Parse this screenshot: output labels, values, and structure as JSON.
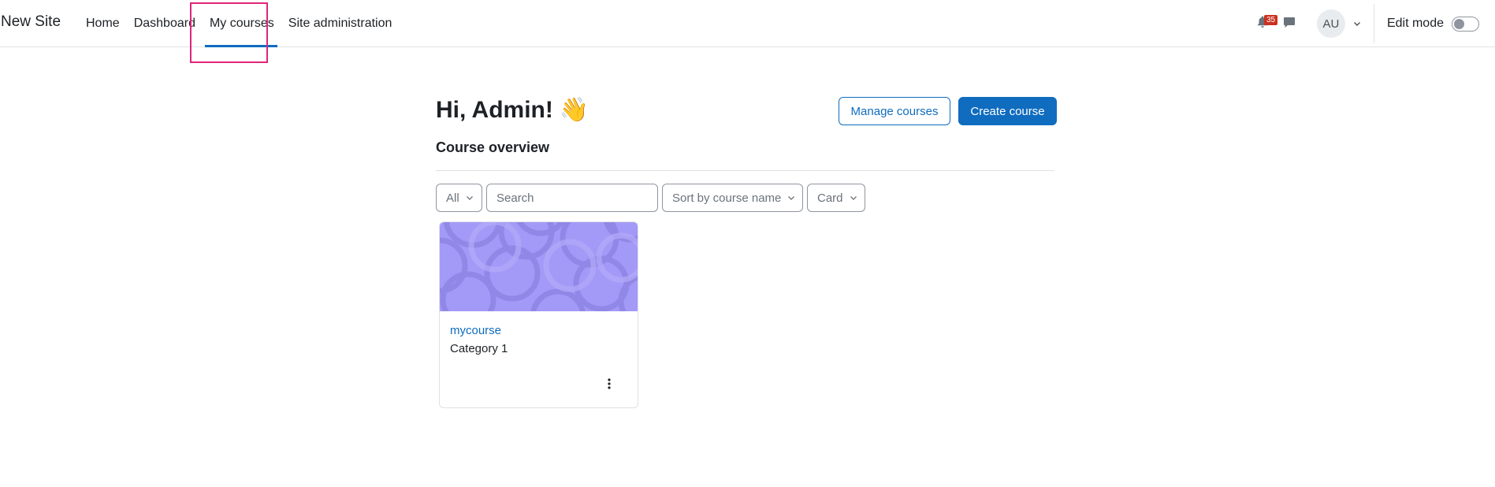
{
  "navbar": {
    "site_name": "New Site",
    "items": [
      {
        "label": "Home"
      },
      {
        "label": "Dashboard"
      },
      {
        "label": "My courses",
        "active": true
      },
      {
        "label": "Site administration"
      }
    ],
    "notifications": {
      "count": "35",
      "icon": "bell-icon"
    },
    "messages": {
      "icon": "chat-icon"
    },
    "user": {
      "initials": "AU"
    },
    "edit_mode": {
      "label": "Edit mode",
      "enabled": false
    }
  },
  "main": {
    "greeting": "Hi, Admin!",
    "greeting_emoji": "👋",
    "manage_courses_label": "Manage courses",
    "create_course_label": "Create course",
    "section_title": "Course overview",
    "filters": {
      "grouping": "All",
      "search_placeholder": "Search",
      "sort": "Sort by course name",
      "view": "Card"
    },
    "courses": [
      {
        "name": "mycourse",
        "category": "Category 1"
      }
    ]
  },
  "colors": {
    "primary": "#0f6cbf",
    "badge": "#ca3120",
    "highlight": "#e0257a",
    "course_image": "#a39af7"
  }
}
